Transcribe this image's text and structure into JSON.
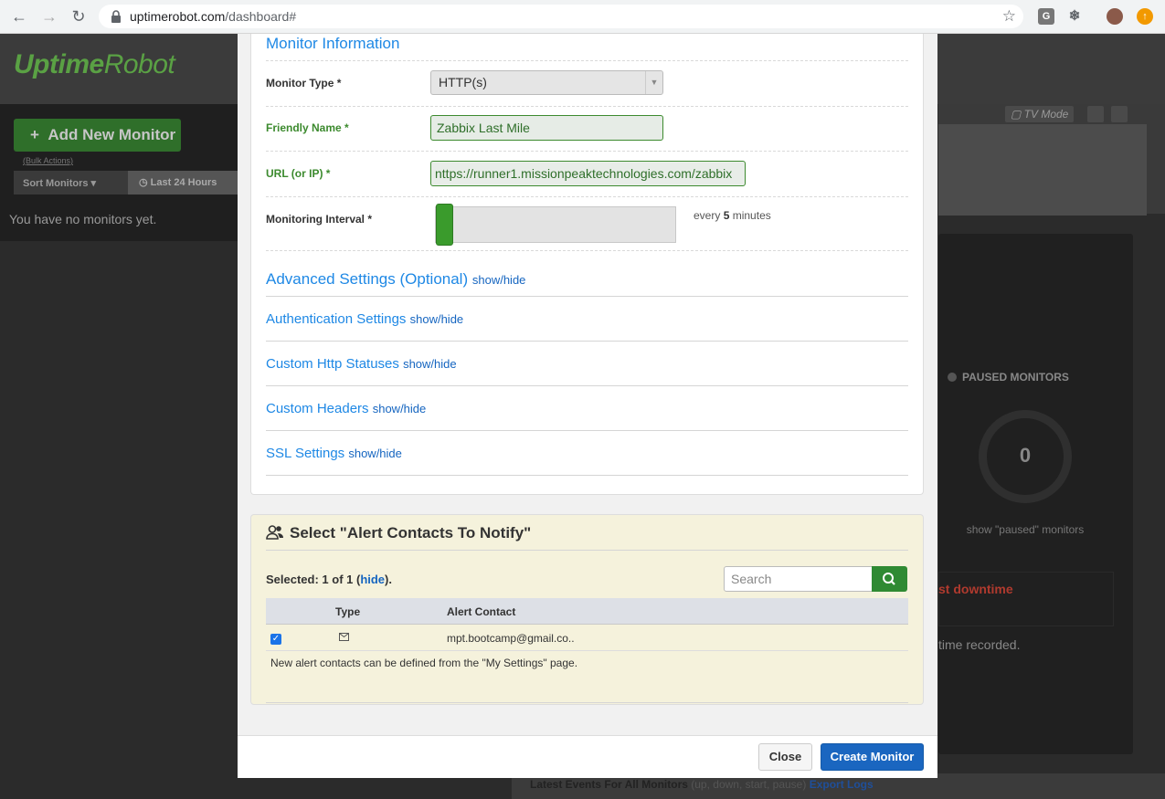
{
  "browser": {
    "url_host": "uptimerobot.com",
    "url_path": "/dashboard#",
    "ext_g": "G"
  },
  "background": {
    "logo_uptime": "Uptime",
    "logo_robot": "Robot",
    "add_monitor_label": "Add New Monitor",
    "bulk_actions": "(Bulk Actions)",
    "sort_monitors": "Sort Monitors",
    "last_24_hours": "Last 24 Hours",
    "no_monitors": "You have no monitors yet.",
    "tv_mode": "TV Mode",
    "paused_monitors": "PAUSED MONITORS",
    "paused_count": "0",
    "show_paused": "show \"paused\" monitors",
    "downtime_fragment": "st downtime",
    "time_recorded_fragment": "time recorded.",
    "latest_events": "Latest Events For All Monitors",
    "latest_events_sub": "(up, down, start, pause)",
    "export_logs": "Export Logs"
  },
  "monitor_info": {
    "section_title": "Monitor Information",
    "monitor_type_label": "Monitor Type *",
    "monitor_type_value": "HTTP(s)",
    "friendly_name_label": "Friendly Name *",
    "friendly_name_value": "Zabbix Last Mile",
    "url_label": "URL (or IP) *",
    "url_value": "nttps://runner1.missionpeaktechnologies.com/zabbix",
    "interval_label": "Monitoring Interval *",
    "interval_prefix": "every",
    "interval_value": "5",
    "interval_suffix": "minutes",
    "interval_fraction": 0.0
  },
  "advanced": {
    "title": "Advanced Settings (Optional)",
    "show_hide": "show/hide",
    "items": [
      {
        "label": "Authentication Settings",
        "toggle": "show/hide"
      },
      {
        "label": "Custom Http Statuses",
        "toggle": "show/hide"
      },
      {
        "label": "Custom Headers",
        "toggle": "show/hide"
      },
      {
        "label": "SSL Settings",
        "toggle": "show/hide"
      }
    ]
  },
  "alerts": {
    "title": "Select \"Alert Contacts To Notify\"",
    "selected_prefix": "Selected: 1 of 1 (",
    "hide_link": "hide",
    "selected_suffix": ").",
    "search_placeholder": "Search",
    "columns": [
      "Type",
      "Alert Contact"
    ],
    "rows": [
      {
        "checked": true,
        "type_icon": "envelope-icon",
        "contact": "mpt.bootcamp@gmail.co.."
      }
    ],
    "note": "New alert contacts can be defined from the \"My Settings\" page."
  },
  "footer": {
    "close_label": "Close",
    "create_label": "Create Monitor"
  },
  "colors": {
    "accent_blue": "#1e88e5",
    "brand_green": "#3a9b2c",
    "primary_button": "#1a66c0"
  }
}
